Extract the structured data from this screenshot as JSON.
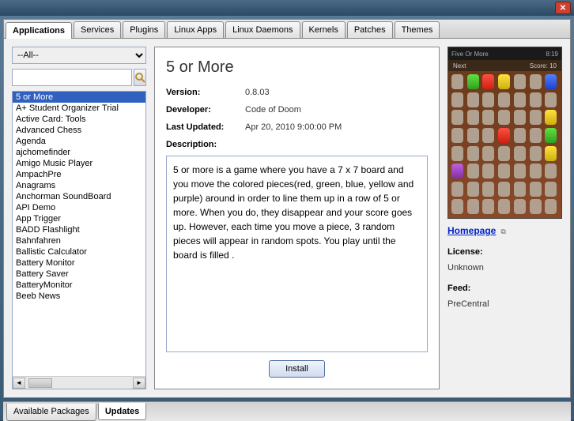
{
  "window": {
    "close": "✕"
  },
  "tabs_top": [
    "Applications",
    "Services",
    "Plugins",
    "Linux Apps",
    "Linux Daemons",
    "Kernels",
    "Patches",
    "Themes"
  ],
  "tabs_top_active": 0,
  "filter": {
    "selected": "--All--"
  },
  "search": {
    "value": "",
    "placeholder": ""
  },
  "package_list": [
    "5 or More",
    "A+ Student Organizer Trial",
    "Active Card: Tools",
    "Advanced Chess",
    "Agenda",
    "ajchomefinder",
    "Amigo Music Player",
    "AmpachPre",
    "Anagrams",
    "Anchorman SoundBoard",
    "API Demo",
    "App Trigger",
    "BADD Flashlight",
    "Bahnfahren",
    "Ballistic Calculator",
    "Battery Monitor",
    "Battery Saver",
    "BatteryMonitor",
    "Beeb News"
  ],
  "selected_index": 0,
  "detail": {
    "title": "5 or More",
    "version_label": "Version:",
    "version": "0.8.03",
    "developer_label": "Developer:",
    "developer": "Code of Doom",
    "updated_label": "Last Updated:",
    "updated": "Apr 20, 2010 9:00:00 PM",
    "description_label": "Description:",
    "description": "5 or more is a game where you have a 7 x 7 board and you move the colored pieces(red, green, blue, yellow and purple) around in order to line them up in a row of 5 or more. When you do, they disappear and your score goes up. However, each time you move a piece, 3 random pieces will appear in random spots.  You play until the board is filled .",
    "install_label": "Install"
  },
  "screenshot": {
    "app_name": "Five Or More",
    "time": "8:19",
    "next_label": "Next",
    "score_label": "Score:",
    "score_value": "10",
    "grid": [
      [
        "",
        "g",
        "r",
        "y",
        "",
        "",
        "b"
      ],
      [
        "",
        "",
        "",
        "",
        "",
        "",
        ""
      ],
      [
        "",
        "",
        "",
        "",
        "",
        "",
        "y"
      ],
      [
        "",
        "",
        "",
        "r",
        "",
        "",
        "g"
      ],
      [
        "",
        "",
        "",
        "",
        "",
        "",
        "y"
      ],
      [
        "p",
        "",
        "",
        "",
        "",
        "",
        ""
      ],
      [
        "",
        "",
        "",
        "",
        "",
        "",
        ""
      ],
      [
        "",
        "",
        "",
        "",
        "",
        "",
        ""
      ]
    ]
  },
  "side": {
    "homepage_label": "Homepage",
    "license_label": "License:",
    "license_value": "Unknown",
    "feed_label": "Feed:",
    "feed_value": "PreCentral"
  },
  "tabs_bottom": [
    "Available Packages",
    "Updates"
  ],
  "tabs_bottom_active": 1
}
